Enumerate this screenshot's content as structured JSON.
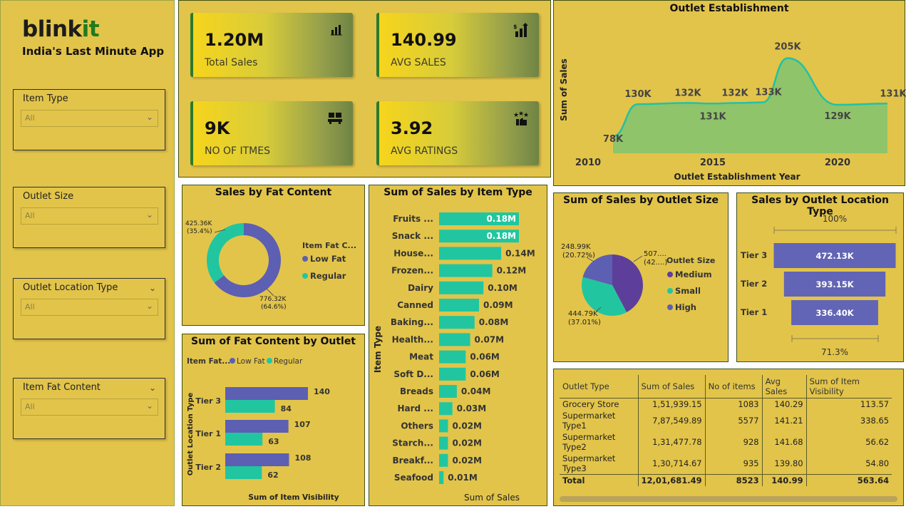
{
  "brand": {
    "name_a": "blink",
    "name_b": "it",
    "tagline": "India's Last Minute App"
  },
  "slicers": [
    {
      "label": "Item Type",
      "value": "All",
      "top_chevron": false
    },
    {
      "label": "Outlet Size",
      "value": "All",
      "top_chevron": false
    },
    {
      "label": "Outlet Location Type",
      "value": "All",
      "top_chevron": true
    },
    {
      "label": "Item Fat Content",
      "value": "All",
      "top_chevron": true
    }
  ],
  "kpis": [
    {
      "value": "1.20M",
      "caption": "Total Sales",
      "icon": "bar-chart-icon"
    },
    {
      "value": "140.99",
      "caption": "AVG SALES",
      "icon": "money-growth-icon"
    },
    {
      "value": "9K",
      "caption": "NO OF ITMES",
      "icon": "boxes-icon"
    },
    {
      "value": "3.92",
      "caption": "AVG RATINGS",
      "icon": "rating-stars-icon"
    }
  ],
  "colors": {
    "background": "#e2c44a",
    "purple": "#5c5fb2",
    "teal": "#21c6a0",
    "area": "#8fc46a",
    "line": "#22c1a4",
    "funnel": "#6264b5"
  },
  "chart_data": [
    {
      "id": "outlet_establishment",
      "type": "area",
      "title": "Outlet Establishment",
      "xlabel": "Outlet Establishment Year",
      "ylabel": "Sum of Sales",
      "x_ticks": [
        "2010",
        "2015",
        "2020"
      ],
      "x": [
        2011,
        2012,
        2014,
        2015,
        2016,
        2017,
        2018,
        2020,
        2022
      ],
      "values": [
        78,
        130,
        132,
        131,
        132,
        133,
        205,
        129,
        131
      ],
      "labels": [
        "78K",
        "130K",
        "132K",
        "131K",
        "132K",
        "133K",
        "205K",
        "129K",
        "131K"
      ],
      "xlim": [
        2010,
        2022
      ]
    },
    {
      "id": "sales_by_fat_content",
      "type": "pie",
      "title": "Sales by Fat Content",
      "legend_title": "Item Fat C...",
      "categories": [
        "Low Fat",
        "Regular"
      ],
      "values": [
        776.32,
        425.36
      ],
      "labels": [
        "776.32K\n(64.6%)",
        "425.36K\n(35.4%)"
      ]
    },
    {
      "id": "sales_by_item_type",
      "type": "bar",
      "title": "Sum of Sales by Item Type",
      "xlabel": "Sum of Sales",
      "ylabel": "Item Type",
      "categories": [
        "Fruits ...",
        "Snack ...",
        "House...",
        "Frozen...",
        "Dairy",
        "Canned",
        "Baking...",
        "Health...",
        "Meat",
        "Soft D...",
        "Breads",
        "Hard ...",
        "Others",
        "Starch...",
        "Breakf...",
        "Seafood"
      ],
      "values": [
        0.18,
        0.18,
        0.14,
        0.12,
        0.1,
        0.09,
        0.08,
        0.07,
        0.06,
        0.06,
        0.04,
        0.03,
        0.02,
        0.02,
        0.02,
        0.01
      ],
      "labels": [
        "0.18M",
        "0.18M",
        "0.14M",
        "0.12M",
        "0.10M",
        "0.09M",
        "0.08M",
        "0.07M",
        "0.06M",
        "0.06M",
        "0.04M",
        "0.03M",
        "0.02M",
        "0.02M",
        "0.02M",
        "0.01M"
      ]
    },
    {
      "id": "fat_content_by_outlet",
      "type": "bar",
      "title": "Sum of Fat Content by Outlet",
      "legend_title": "Item Fat...",
      "xlabel": "Sum of Item Visibility",
      "ylabel": "Outlet Location Type",
      "categories": [
        "Tier 3",
        "Tier 1",
        "Tier 2"
      ],
      "series": [
        {
          "name": "Low Fat",
          "values": [
            140,
            107,
            108
          ]
        },
        {
          "name": "Regular",
          "values": [
            84,
            63,
            62
          ]
        }
      ]
    },
    {
      "id": "sales_by_outlet_size",
      "type": "pie",
      "title": "Sum of Sales by Outlet Size",
      "legend_title": "Outlet Size",
      "categories": [
        "Medium",
        "Small",
        "High"
      ],
      "values": [
        507.9,
        444.79,
        248.99
      ],
      "labels": [
        "507....\n(42....)",
        "444.79K\n(37.01%)",
        "248.99K\n(20.72%)"
      ]
    },
    {
      "id": "sales_by_location_type",
      "type": "bar",
      "title": "Sales by Outlet Location Type",
      "categories": [
        "Tier 3",
        "Tier 2",
        "Tier 1"
      ],
      "values": [
        472.13,
        393.15,
        336.4
      ],
      "labels": [
        "472.13K",
        "393.15K",
        "336.40K"
      ],
      "top_pct": "100%",
      "bottom_pct": "71.3%"
    },
    {
      "id": "outlet_table",
      "type": "table",
      "columns": [
        "Outlet Type",
        "Sum of Sales",
        "No of items",
        "Avg Sales",
        "Sum of Item Visibility"
      ],
      "rows": [
        [
          "Grocery Store",
          "1,51,939.15",
          "1083",
          "140.29",
          "113.57"
        ],
        [
          "Supermarket Type1",
          "7,87,549.89",
          "5577",
          "141.21",
          "338.65"
        ],
        [
          "Supermarket Type2",
          "1,31,477.78",
          "928",
          "141.68",
          "56.62"
        ],
        [
          "Supermarket Type3",
          "1,30,714.67",
          "935",
          "139.80",
          "54.80"
        ]
      ],
      "total": [
        "Total",
        "12,01,681.49",
        "8523",
        "140.99",
        "563.64"
      ]
    }
  ]
}
